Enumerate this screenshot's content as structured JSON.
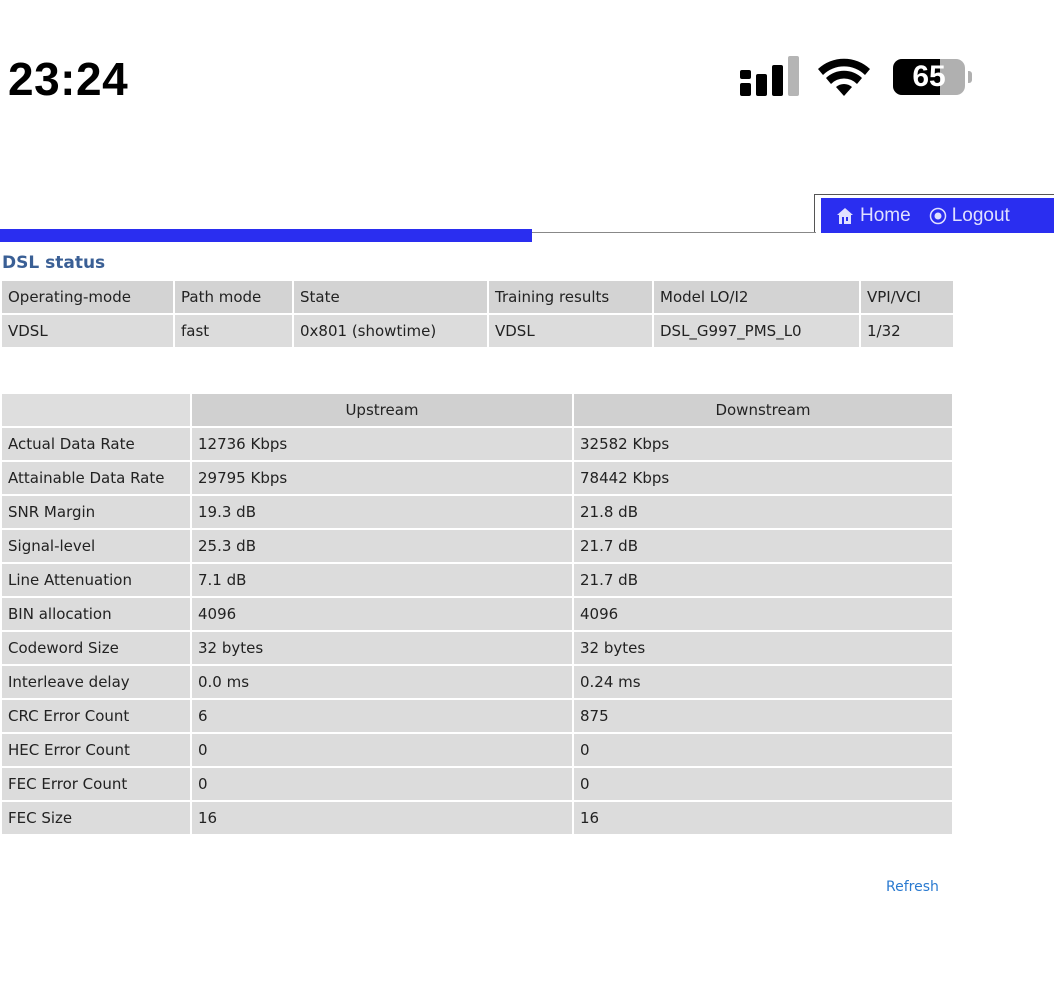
{
  "status_bar": {
    "time": "23:24",
    "battery_level": "65",
    "battery_fraction": 0.65,
    "icons": [
      "signal-icon",
      "wifi-icon",
      "battery-icon"
    ]
  },
  "nav": {
    "home_label": "Home",
    "logout_label": "Logout",
    "accent_color": "#2a2ef0"
  },
  "page": {
    "title": "DSL status",
    "refresh_label": "Refresh"
  },
  "summary_table": {
    "headers": [
      "Operating-mode",
      "Path mode",
      "State",
      "Training results",
      "Model LO/I2",
      "VPI/VCI"
    ],
    "values": [
      "VDSL",
      "fast",
      "0x801 (showtime)",
      "VDSL",
      "DSL_G997_PMS_L0",
      "1/32"
    ]
  },
  "stats_table": {
    "headers": [
      "",
      "Upstream",
      "Downstream"
    ],
    "rows": [
      [
        "Actual Data Rate",
        "12736 Kbps",
        "32582 Kbps"
      ],
      [
        "Attainable Data Rate",
        "29795 Kbps",
        "78442 Kbps"
      ],
      [
        "SNR Margin",
        "19.3 dB",
        "21.8 dB"
      ],
      [
        "Signal-level",
        "25.3 dB",
        "21.7 dB"
      ],
      [
        "Line Attenuation",
        "7.1 dB",
        "21.7 dB"
      ],
      [
        "BIN allocation",
        "4096",
        "4096"
      ],
      [
        "Codeword Size",
        "32 bytes",
        "32 bytes"
      ],
      [
        "Interleave delay",
        "0.0 ms",
        "0.24 ms"
      ],
      [
        "CRC Error Count",
        "6",
        "875"
      ],
      [
        "HEC Error Count",
        "0",
        "0"
      ],
      [
        "FEC Error Count",
        "0",
        "0"
      ],
      [
        "FEC Size",
        "16",
        "16"
      ]
    ]
  }
}
